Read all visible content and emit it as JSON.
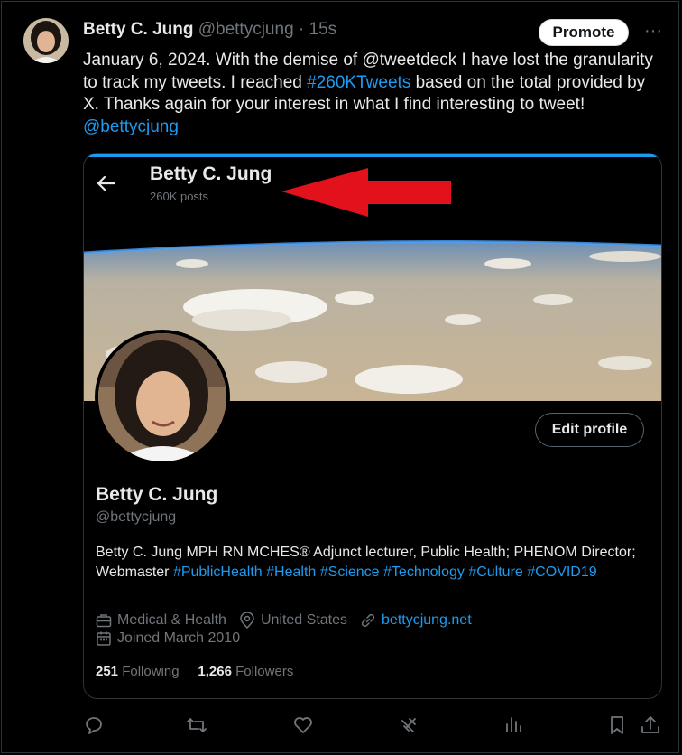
{
  "tweet": {
    "author_name": "Betty C. Jung",
    "author_handle": "@bettycjung",
    "separator": "·",
    "time_ago": "15s",
    "promote_label": "Promote",
    "more_label": "···",
    "text_part1": "January 6, 2024.  With the demise of @tweetdeck I have lost the granularity to track my tweets. I reached ",
    "hashtag": "#260KTweets",
    "text_part2": " based on the total provided by X. Thanks again for your interest in what I find interesting to tweet! ",
    "mention": "@bettycjung"
  },
  "card": {
    "header_name": "Betty C. Jung",
    "header_posts": "260K posts",
    "edit_profile_label": "Edit profile",
    "profile_name": "Betty C. Jung",
    "profile_handle": "@bettycjung",
    "bio_text": "Betty C. Jung MPH RN MCHES® Adjunct lecturer, Public Health; PHENOM Director; Webmaster ",
    "bio_tags": [
      "#PublicHealth",
      "#Health",
      "#Science",
      "#Technology",
      "#Culture",
      "#COVID19"
    ],
    "category": "Medical & Health",
    "location": "United States",
    "website": "bettycjung.net",
    "joined": "Joined March 2010",
    "following_count": "251",
    "following_label": "Following",
    "followers_count": "1,266",
    "followers_label": "Followers"
  },
  "actions": [
    "reply-icon",
    "retweet-icon",
    "like-icon",
    "grok-icon",
    "views-icon",
    "bookmark-icon",
    "share-icon"
  ],
  "colors": {
    "accent": "#1d9bf0",
    "arrow": "#e3111b",
    "muted": "#71767b"
  }
}
